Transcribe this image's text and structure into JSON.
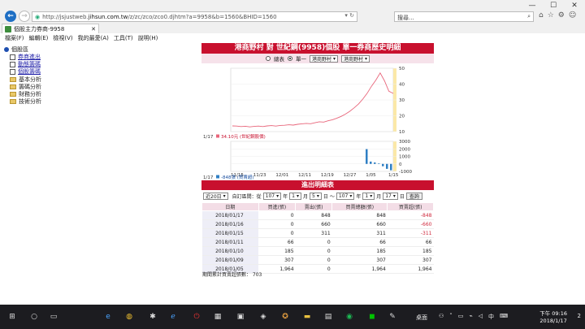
{
  "browser": {
    "url_prefix": "http://jsjustweb.",
    "url_domain": "jihsun.com.tw",
    "url_rest": "/z/zc/zco/zco0.djhtm?a=9958&b=1560&BHID=1560",
    "search_placeholder": "搜尋...",
    "tab_title": "個股主力券商-9958",
    "menu": [
      "檔案(F)",
      "編輯(E)",
      "檢視(V)",
      "我的最愛(A)",
      "工具(T)",
      "說明(H)"
    ]
  },
  "sidebar": {
    "root": "個股區",
    "items": [
      {
        "label": "券商進出",
        "link": true
      },
      {
        "label": "動態籌碼",
        "link": true
      },
      {
        "label": "個股籌碼",
        "link": true
      },
      {
        "label": "基本分析",
        "link": false
      },
      {
        "label": "籌碼分析",
        "link": false
      },
      {
        "label": "財務分析",
        "link": false
      },
      {
        "label": "技術分析",
        "link": false
      }
    ]
  },
  "main": {
    "title": "港商野村 對 世紀鋼(9958)個股 單一券商歷史明細",
    "radio_total": "總表",
    "radio_single": "單一",
    "broker_select_1": "港商野村",
    "broker_select_2": "港商野村",
    "table_title": "進出明細表",
    "filter": {
      "period": "近20日",
      "custom_label": "自訂區間：從",
      "from_year": "107",
      "from_month": "1",
      "from_day": "5",
      "year_unit": "年",
      "month_unit": "月",
      "day_unit": "日",
      "to_sep": "～",
      "to_year": "107",
      "to_month": "1",
      "to_day": "17",
      "query_btn": "查詢"
    },
    "table_headers": [
      "日期",
      "買進(張)",
      "賣出(張)",
      "買賣總額(張)",
      "買賣超(張)"
    ],
    "rows": [
      [
        "2018/01/17",
        "0",
        "848",
        "848",
        "-848"
      ],
      [
        "2018/01/16",
        "0",
        "660",
        "660",
        "-660"
      ],
      [
        "2018/01/15",
        "0",
        "311",
        "311",
        "-311"
      ],
      [
        "2018/01/11",
        "66",
        "0",
        "66",
        "66"
      ],
      [
        "2018/01/10",
        "185",
        "0",
        "185",
        "185"
      ],
      [
        "2018/01/09",
        "307",
        "0",
        "307",
        "307"
      ],
      [
        "2018/01/05",
        "1,964",
        "0",
        "1,964",
        "1,964"
      ]
    ],
    "summary": "期間累計買賣超張數： 703"
  },
  "chart_data": [
    {
      "type": "line",
      "title": "",
      "legend_date": "1/17",
      "legend_text": "34.10元 (世紀鋼股價)",
      "color": "#e8657a",
      "y_ticks": [
        "50",
        "40",
        "30",
        "20",
        "10"
      ],
      "ylim": [
        10,
        50
      ],
      "values": [
        13.6,
        13.5,
        13.2,
        13.4,
        13.0,
        13.3,
        13.5,
        13.2,
        13.6,
        13.8,
        13.5,
        13.9,
        14.0,
        14.3,
        14.1,
        14.6,
        14.9,
        15.2,
        15.0,
        15.6,
        16.2,
        16.0,
        16.8,
        17.5,
        18.4,
        19.6,
        21.0,
        22.8,
        25.0,
        27.4,
        30.5,
        34.2,
        38.6,
        42.5,
        47.0,
        42.0,
        35.5,
        34.1
      ]
    },
    {
      "type": "bar",
      "title": "",
      "legend_date": "1/17",
      "legend_text": "-848張 (買賣超)",
      "color": "#2f7fc4",
      "x_ticks": [
        "11/15",
        "11/23",
        "12/01",
        "12/11",
        "12/19",
        "12/27",
        "1/05",
        "1/15"
      ],
      "y_ticks": [
        "3000",
        "2000",
        "1000",
        "0",
        "-1000"
      ],
      "ylim": [
        -1000,
        3000
      ],
      "categories": [
        "2018/01/05",
        "2018/01/09",
        "2018/01/10",
        "2018/01/11",
        "2018/01/15",
        "2018/01/16",
        "2018/01/17"
      ],
      "values": [
        1964,
        307,
        185,
        66,
        -311,
        -660,
        -848
      ]
    }
  ],
  "taskbar": {
    "desktop_label": "桌面",
    "ime": "中",
    "time": "下午 09:16",
    "date": "2018/1/17",
    "notif_count": "2"
  }
}
